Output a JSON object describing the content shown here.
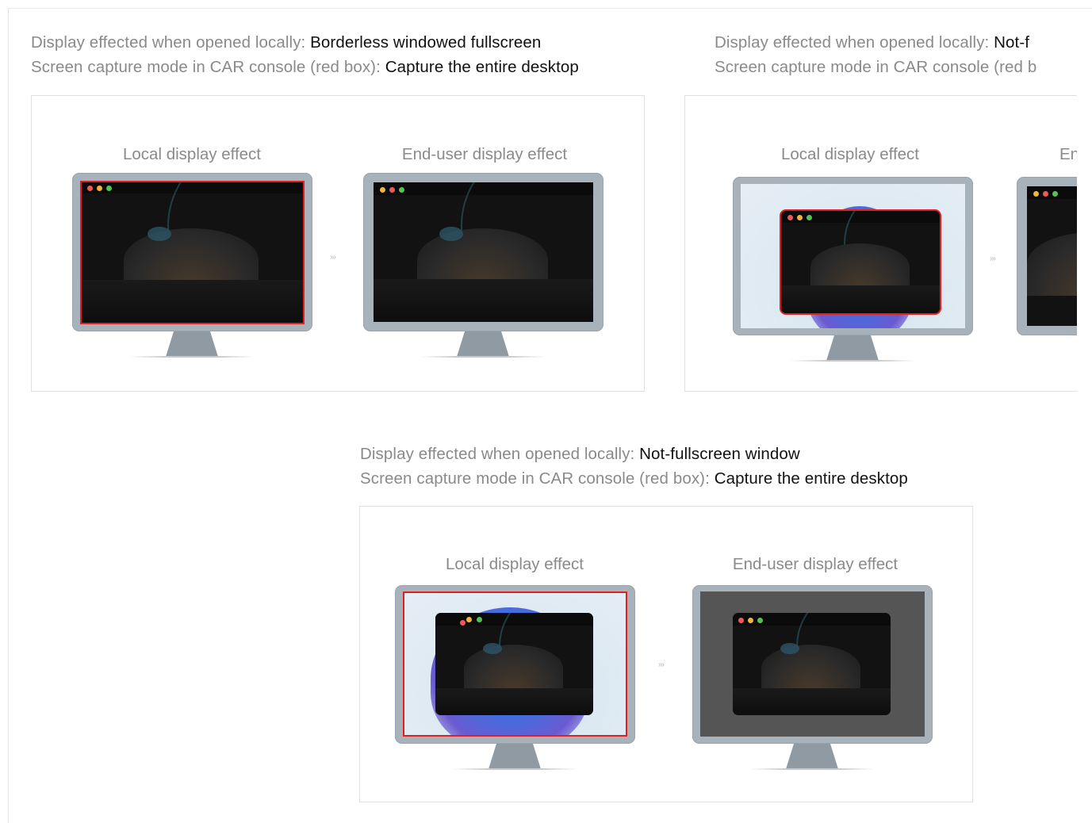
{
  "labels": {
    "display_prefix": "Display effected when opened locally: ",
    "capture_prefix": "Screen capture mode in CAR console (red box): ",
    "local_caption": "Local display effect",
    "enduser_caption": "End-user display effect",
    "arrow_glyph": "›››"
  },
  "scenarios": [
    {
      "display_value": "Borderless windowed fullscreen",
      "capture_value": "Capture the entire desktop",
      "local_caption": "Local display effect",
      "enduser_caption": "End-user display effect"
    },
    {
      "display_value": "Not-f",
      "capture_prefix_cut": "Screen capture mode in CAR console (red b",
      "local_caption": "Local display effect",
      "enduser_caption": "End-"
    },
    {
      "display_value": "Not-fullscreen window",
      "capture_value": "Capture the entire desktop",
      "local_caption": "Local display effect",
      "enduser_caption": "End-user display effect"
    }
  ],
  "colors": {
    "red_box": "#e21f1f",
    "bezel": "#a8b2ba",
    "text_grey": "#8a8a8a",
    "text_dark": "#111111",
    "enduser_bg_dark": "#555555"
  }
}
